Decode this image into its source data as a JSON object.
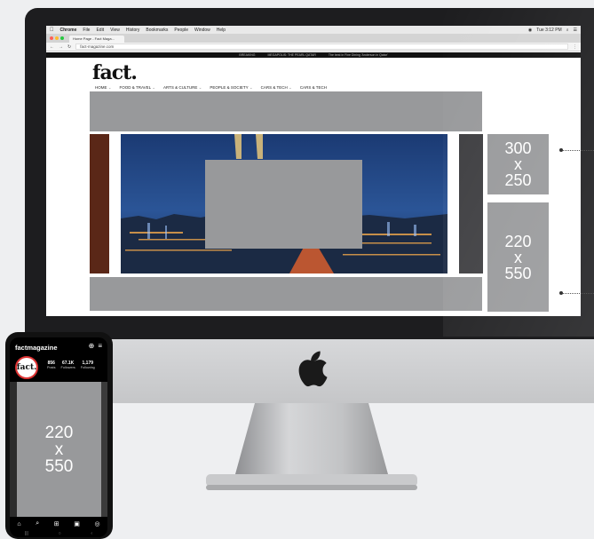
{
  "menubar": {
    "apple": "",
    "items": [
      "Chrome",
      "File",
      "Edit",
      "View",
      "History",
      "Bookmarks",
      "People",
      "Window",
      "Help"
    ],
    "clock": "Tue 3:12 PM"
  },
  "browser": {
    "tab_title": "Home Page - Fact Maga...",
    "url": "fact-magazine.com"
  },
  "site": {
    "breaking_label": "BREAKING",
    "breaking_headline": "MEGAPOLIS: THE PEARL QATAR",
    "breaking_right": "The best in Fine Dining 'Anderson in Qatar'",
    "logo": "fact.",
    "nav": [
      "HOME",
      "FOOD & TRAVEL",
      "ARTS & CULTURE",
      "PEOPLE & SOCIETY",
      "CARS & TECH",
      "CARS & TECH"
    ]
  },
  "ads": {
    "side_top": "300\nx\n250",
    "side_bottom": "220\nx\n550",
    "phone": "220\nx\n550"
  },
  "phone": {
    "handle": "factmagazine",
    "avatar_text": "fact.",
    "posts_num": "856",
    "posts_lbl": "Posts",
    "followers_num": "67.1K",
    "followers_lbl": "Followers",
    "following_num": "1,179",
    "following_lbl": "Following"
  },
  "colors": {
    "ad_gray": "#98999b",
    "imac_bezel": "#1d1d1f",
    "imac_chin": "#d7d8da"
  }
}
